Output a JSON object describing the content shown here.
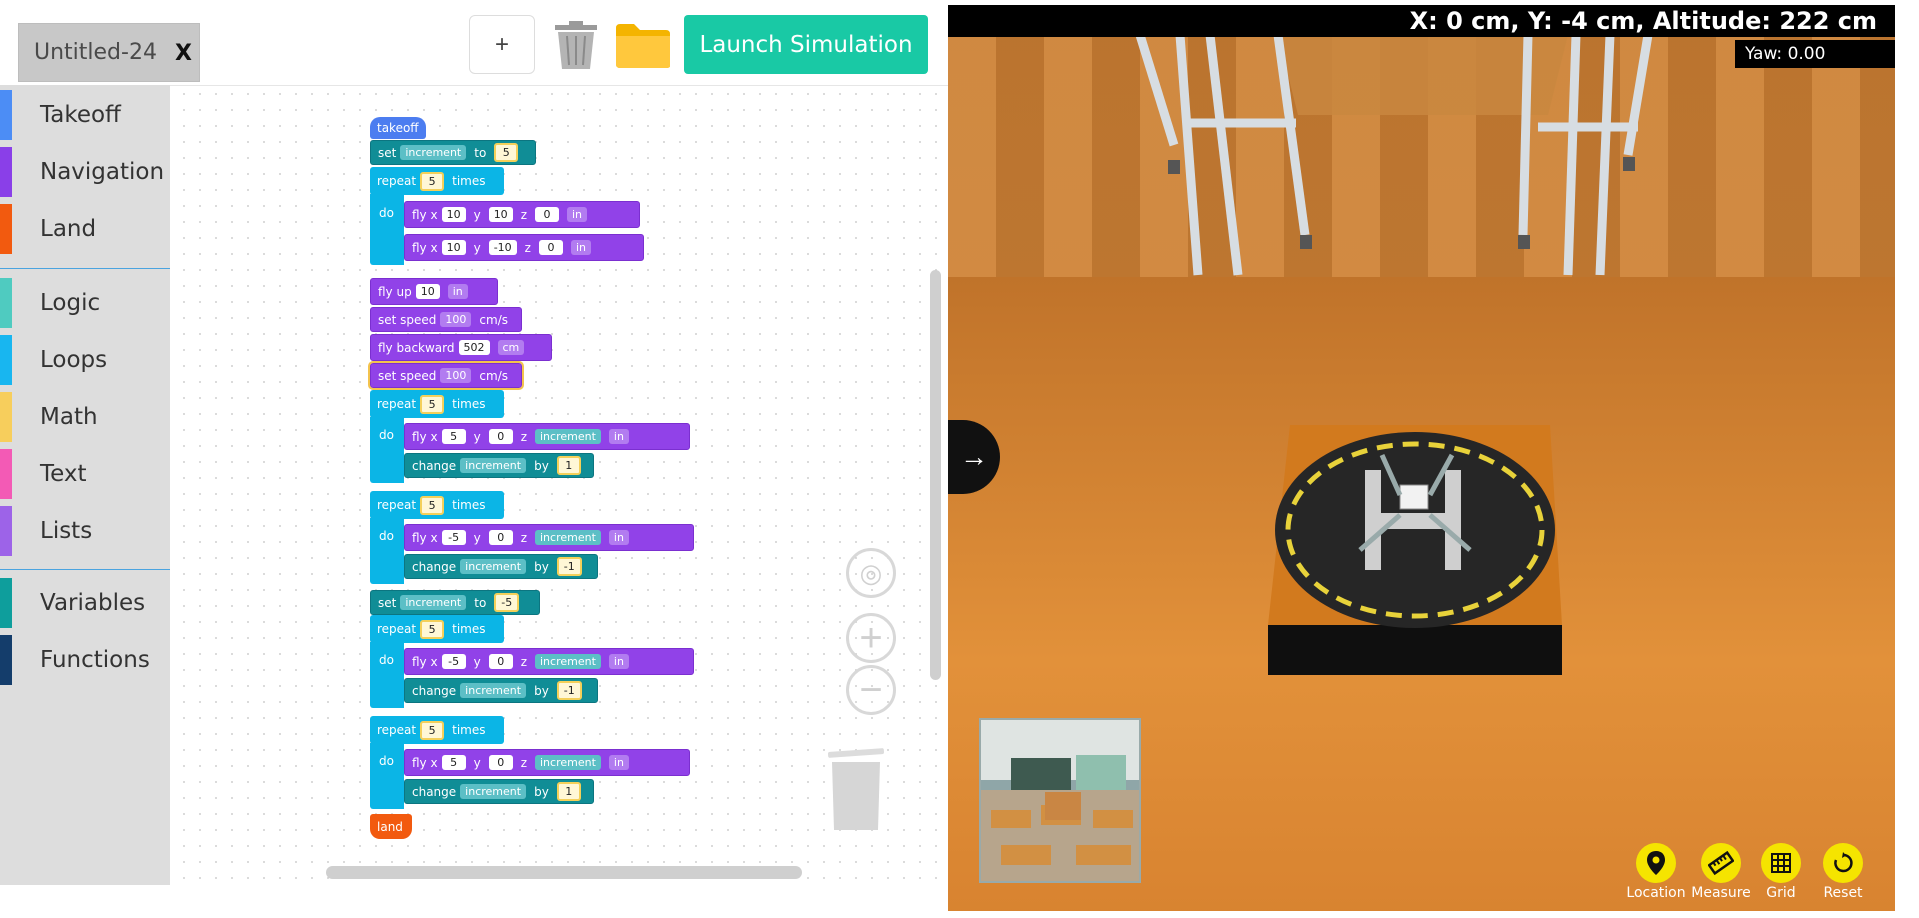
{
  "file_tab": {
    "name": "Untitled-24",
    "close": "X"
  },
  "toolbar": {
    "plus": "+",
    "launch": "Launch Simulation",
    "trash_icon": "trash-icon",
    "folder_icon": "folder-icon"
  },
  "toolbox": {
    "categories": [
      {
        "label": "Takeoff",
        "color": "#4c8df5"
      },
      {
        "label": "Navigation",
        "color": "#8a3fe8"
      },
      {
        "label": "Land",
        "color": "#f25a0f"
      },
      {
        "label": "Logic",
        "color": "#4fcbc0"
      },
      {
        "label": "Loops",
        "color": "#18b6f0"
      },
      {
        "label": "Math",
        "color": "#f7ce5c"
      },
      {
        "label": "Text",
        "color": "#f35ab5"
      },
      {
        "label": "Lists",
        "color": "#9d63e8"
      },
      {
        "label": "Variables",
        "color": "#0e9e9c"
      },
      {
        "label": "Functions",
        "color": "#143d6b"
      }
    ]
  },
  "blocks": {
    "takeoff": "takeoff",
    "land": "land",
    "set": "set",
    "to": "to",
    "repeat": "repeat",
    "times": "times",
    "do": "do",
    "fly_x": "fly x",
    "y": "y",
    "z": "z",
    "fly_up": "fly up",
    "set_speed": "set speed",
    "fly_backward": "fly backward",
    "change": "change",
    "by": "by",
    "cms": "cm/s",
    "var": "increment",
    "in": "in",
    "cm": "cm",
    "v5": "5",
    "v10": "10",
    "vm10": "-10",
    "v0": "0",
    "v100": "100",
    "v502": "502",
    "v1": "1",
    "vm1": "-1",
    "vm5": "-5"
  },
  "sim": {
    "coords": "X: 0 cm, Y: -4 cm, Altitude: 222 cm",
    "yaw": "Yaw: 0.00",
    "toggle": "→",
    "tools": [
      {
        "label": "Location",
        "icon": "location-pin-icon"
      },
      {
        "label": "Measure",
        "icon": "ruler-icon"
      },
      {
        "label": "Grid",
        "icon": "grid-icon"
      },
      {
        "label": "Reset",
        "icon": "reset-icon"
      }
    ]
  }
}
